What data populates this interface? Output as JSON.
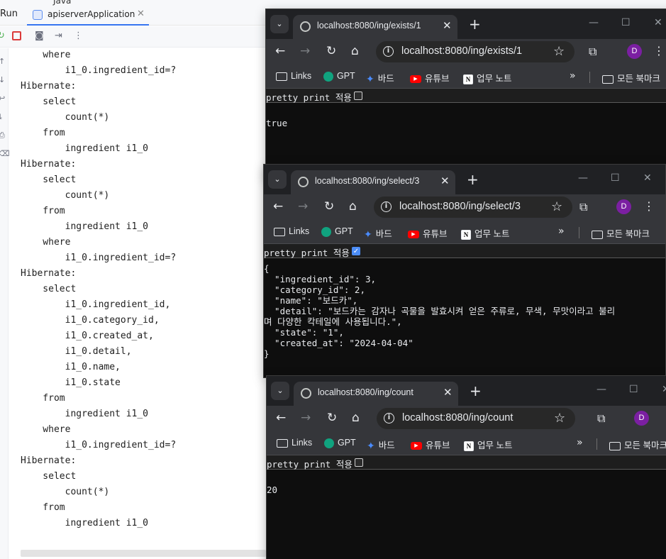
{
  "ide": {
    "tree_fragment": "Java",
    "run_label": "Run",
    "tab": {
      "label": "apiserverApplication",
      "close": "✕"
    },
    "console_lines": [
      "    where",
      "        i1_0.ingredient_id=?",
      "Hibernate:",
      "    select",
      "        count(*)",
      "    from",
      "        ingredient i1_0",
      "Hibernate:",
      "    select",
      "        count(*)",
      "    from",
      "        ingredient i1_0",
      "    where",
      "        i1_0.ingredient_id=?",
      "Hibernate:",
      "    select",
      "        i1_0.ingredient_id,",
      "        i1_0.category_id,",
      "        i1_0.created_at,",
      "        i1_0.detail,",
      "        i1_0.name,",
      "        i1_0.state",
      "    from",
      "        ingredient i1_0",
      "    where",
      "        i1_0.ingredient_id=?",
      "Hibernate:",
      "    select",
      "        count(*)",
      "    from",
      "        ingredient i1_0"
    ]
  },
  "bookmarks": {
    "links": "Links",
    "gpt": "GPT",
    "bard": "바드",
    "youtube": "유튜브",
    "notes": "업무 노트",
    "more": "»",
    "all": "모든 북마크"
  },
  "pretty_print_label": "pretty print 적용",
  "windows": {
    "exists": {
      "tab_title": "localhost:8080/ing/exists/1",
      "url": "localhost:8080/ing/exists/1",
      "avatar": "D",
      "pretty_checked": false,
      "body": "true"
    },
    "select": {
      "tab_title": "localhost:8080/ing/select/3",
      "url": "localhost:8080/ing/select/3",
      "avatar": "D",
      "pretty_checked": true,
      "body_lines": [
        "{",
        "  \"ingredient_id\": 3,",
        "  \"category_id\": 2,",
        "  \"name\": \"보드카\",",
        "  \"detail\": \"보드카는 감자나 곡물을 발효시켜 얻은 주류로, 무색, 무맛이라고 불리",
        "며 다양한 칵테일에 사용됩니다.\",",
        "  \"state\": \"1\",",
        "  \"created_at\": \"2024-04-04\"",
        "}"
      ]
    },
    "count": {
      "tab_title": "localhost:8080/ing/count",
      "url": "localhost:8080/ing/count",
      "avatar": "D",
      "pretty_checked": false,
      "body": "20"
    }
  }
}
